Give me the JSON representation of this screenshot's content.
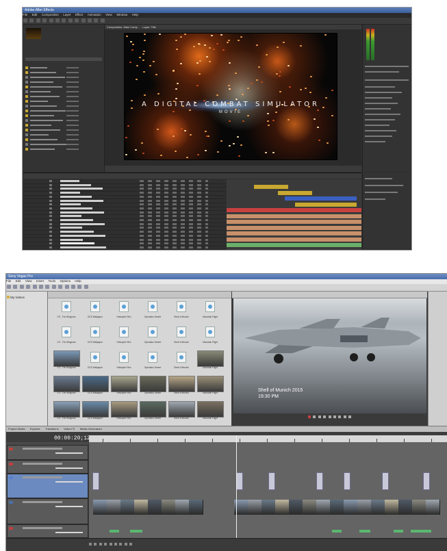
{
  "after_effects": {
    "title": "Adobe After Effects",
    "menu": [
      "File",
      "Edit",
      "Composition",
      "Layer",
      "Effect",
      "Animation",
      "View",
      "Window",
      "Help"
    ],
    "viewer_tabs": [
      "Composition: Main Comp",
      "Layer: Title"
    ],
    "composition_title": "A DIGITAL COMBAT SIMULATOR",
    "composition_subtitle": "MOVIE",
    "track_bar_colors": [
      "#c8a830",
      "#c8a830",
      "#3a5fc0",
      "#c8a830",
      "#c84040",
      "#c8906a",
      "#c8906a",
      "#c8906a",
      "#c8906a",
      "#c8906a",
      "#6ab06a"
    ]
  },
  "vegas": {
    "title": "Sony Vegas Pro",
    "menu": [
      "File",
      "Edit",
      "View",
      "Insert",
      "Tools",
      "Options",
      "Help"
    ],
    "tree_item": "My Videos",
    "tabs": [
      "Project Media",
      "Explorer",
      "Transitions",
      "Video FX",
      "Media Generators"
    ],
    "preview_caption_line1": "Shell of Munich 2015",
    "preview_caption_line2": "19:30 PM",
    "timecode": "00:00:20;12"
  }
}
